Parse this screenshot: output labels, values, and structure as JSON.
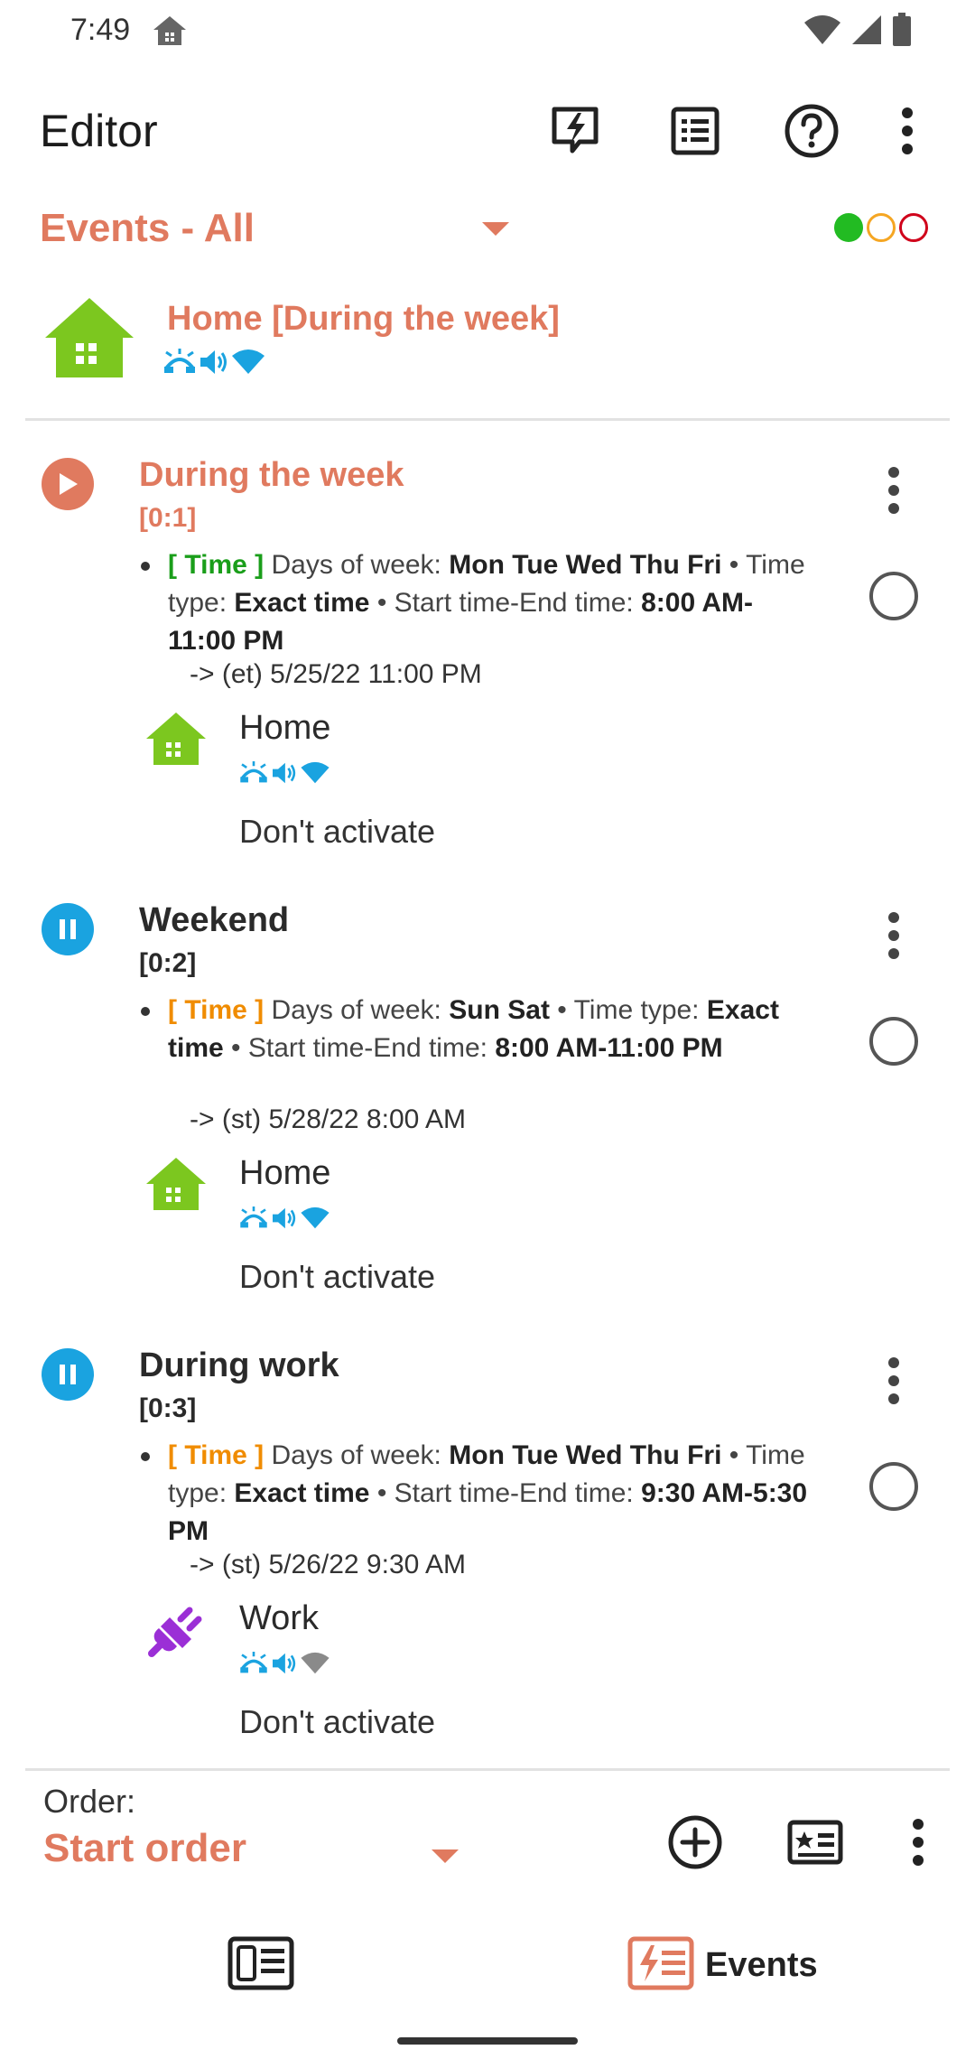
{
  "status_bar": {
    "time": "7:49"
  },
  "app_bar": {
    "title": "Editor",
    "icons": [
      "activated-profile-icon",
      "list-icon",
      "help-icon",
      "more-icon"
    ]
  },
  "filter": {
    "label": "Events - All",
    "indicator_colors": [
      "#22bb22",
      "#f5a623",
      "#d0021b"
    ]
  },
  "profile_header": {
    "name": "Home [During the week]",
    "icon": "house-icon",
    "icon_color": "#7cc71f"
  },
  "events": [
    {
      "name": "During the week",
      "order": "[0:1]",
      "state": "running",
      "state_color": "#e07a5f",
      "name_color": "#e07a5f",
      "tag": "[ Time ]",
      "tag_color": "#1a9e1a",
      "days_label": "Days of week:",
      "days_value": "Mon Tue Wed Thu Fri",
      "sep1": "•",
      "type_label": "Time type:",
      "type_value": "Exact time",
      "sep2": "•",
      "range_label": "Start time-End time:",
      "range_value": "8:00 AM-11:00 PM",
      "next_time": "-> (et) 5/25/22 11:00 PM",
      "profile_name": "Home",
      "profile_icon": "house-icon",
      "profile_icon_color": "#7cc71f",
      "after_end": "Don't activate"
    },
    {
      "name": "Weekend",
      "order": "[0:2]",
      "state": "paused",
      "state_color": "#1aa3e0",
      "name_color": "#2a2a2a",
      "tag": "[ Time ]",
      "tag_color": "#f08c00",
      "days_label": "Days of week:",
      "days_value": "Sun Sat",
      "sep1": "•",
      "type_label": "Time type:",
      "type_value": "Exact time",
      "sep2": "•",
      "range_label": "Start time-End time:",
      "range_value": "8:00 AM-11:00 PM",
      "next_time": "-> (st) 5/28/22 8:00 AM",
      "profile_name": "Home",
      "profile_icon": "house-icon",
      "profile_icon_color": "#7cc71f",
      "after_end": "Don't activate"
    },
    {
      "name": "During work",
      "order": "[0:3]",
      "state": "paused",
      "state_color": "#1aa3e0",
      "name_color": "#2a2a2a",
      "tag": "[ Time ]",
      "tag_color": "#f08c00",
      "days_label": "Days of week:",
      "days_value": "Mon Tue Wed Thu Fri",
      "sep1": "•",
      "type_label": "Time type:",
      "type_value": "Exact time",
      "sep2": "•",
      "range_label": "Start time-End time:",
      "range_value": "9:30 AM-5:30 PM",
      "next_time": "-> (st) 5/26/22 9:30 AM",
      "profile_name": "Work",
      "profile_icon": "plug-icon",
      "profile_icon_color": "#9b2fd6",
      "after_end": "Don't activate"
    }
  ],
  "order_bar": {
    "label": "Order:",
    "value": "Start order",
    "icons": [
      "add-icon",
      "id-card-icon",
      "more-icon"
    ]
  },
  "bottom_nav": {
    "profiles_icon": "profiles-icon",
    "events_label": "Events"
  },
  "colors": {
    "accent": "#e07a5f",
    "status_blue": "#1aa3e0"
  }
}
